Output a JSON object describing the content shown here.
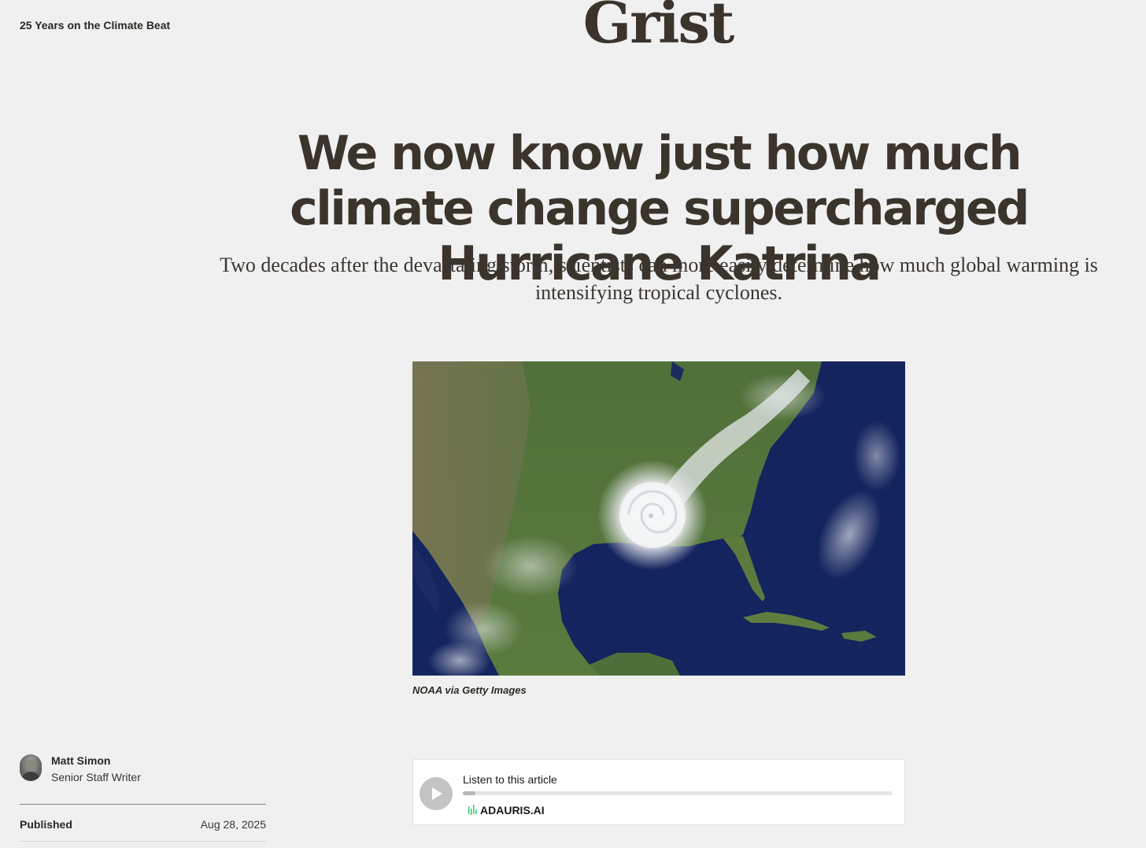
{
  "header": {
    "kicker_link": "25 Years on the Climate Beat",
    "logo_text": "Grist"
  },
  "article": {
    "headline": "We now know just how much climate change supercharged Hurricane Katrina",
    "dek": "Two decades after the devastating storm, scientists can more easily determine how much global warming is intensifying tropical cyclones.",
    "image_icon": "satellite-photo",
    "image_credit": "NOAA via Getty Images"
  },
  "byline": {
    "author_name": "Matt Simon",
    "author_title": "Senior Staff Writer",
    "published_label": "Published",
    "published_date": "Aug 28, 2025"
  },
  "audio_player": {
    "label": "Listen to this article",
    "progress_fraction": 0.03,
    "brand": "ADAURIS.AI",
    "play_icon": "play-icon",
    "brand_color": "#2ecc71"
  },
  "colors": {
    "background": "#f0f0f0",
    "text": "#3a342c"
  }
}
